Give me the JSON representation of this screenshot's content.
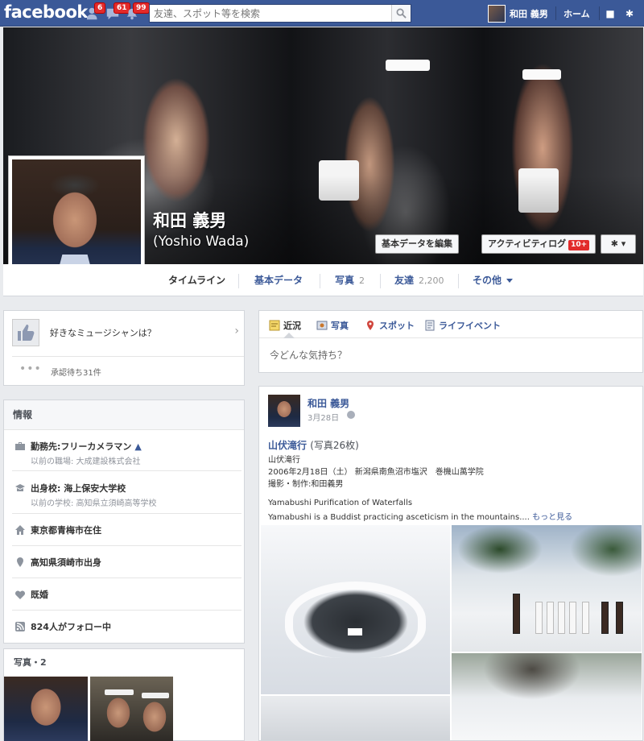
{
  "topbar": {
    "logo": "facebook",
    "badges": {
      "friend_requests": "6",
      "messages": "61",
      "notifications": "99"
    },
    "search_placeholder": "友達、スポット等を検索",
    "user_name": "和田 義男",
    "home": "ホーム",
    "icons": [
      "friend-requests-icon",
      "messages-icon",
      "notifications-icon",
      "search-icon",
      "privacy-lock-icon",
      "settings-gear-icon"
    ]
  },
  "profile": {
    "name": "和田 義男",
    "alt_name": "(Yoshio Wada)",
    "edit_button": "基本データを編集",
    "activity_button": "アクティビティログ",
    "activity_count": "10+",
    "settings_icon": "gear-icon"
  },
  "tabs": [
    {
      "label": "タイムライン"
    },
    {
      "label": "基本データ"
    },
    {
      "label": "写真",
      "count": "2"
    },
    {
      "label": "友達",
      "count": "2,200"
    },
    {
      "label": "その他"
    }
  ],
  "music": {
    "question": "好きなミュージシャンは？",
    "pending": "承認待ち31件"
  },
  "info": {
    "title": "情報",
    "rows": [
      {
        "icon": "briefcase-icon",
        "main": "勤務先:フリーカメラマン",
        "sub": "以前の職場: 大成建設株式会社"
      },
      {
        "icon": "school-icon",
        "main": "出身校: 海上保安大学校",
        "sub": "以前の学校: 高知県立須崎高等学校"
      },
      {
        "icon": "home-icon",
        "main": "東京都青梅市在住"
      },
      {
        "icon": "location-pin-icon",
        "main": "高知県須崎市出身"
      },
      {
        "icon": "heart-icon",
        "main": "既婚"
      },
      {
        "icon": "rss-icon",
        "main": "824人がフォロー中"
      }
    ]
  },
  "photos_panel": {
    "title": "写真・2"
  },
  "composer": {
    "tabs": [
      {
        "label": "近況",
        "icon": "status-icon"
      },
      {
        "label": "写真",
        "icon": "photo-icon"
      },
      {
        "label": "スポット",
        "icon": "place-icon"
      },
      {
        "label": "ライフイベント",
        "icon": "life-event-icon"
      }
    ],
    "placeholder": "今どんな気持ち？"
  },
  "post": {
    "author": "和田 義男",
    "date": "3月28日",
    "album_title": "山伏滝行",
    "album_count": "(写真26枚)",
    "lines": [
      "山伏滝行",
      "2006年2月18日（土） 新潟県南魚沼市塩沢　巻機山萬学院",
      "撮影・制作:和田義男",
      "",
      "Yamabushi Purification of Waterfalls",
      "Yamabushi is a Buddist practicing asceticism in the mountains...."
    ],
    "more_link": "もっと見る"
  }
}
